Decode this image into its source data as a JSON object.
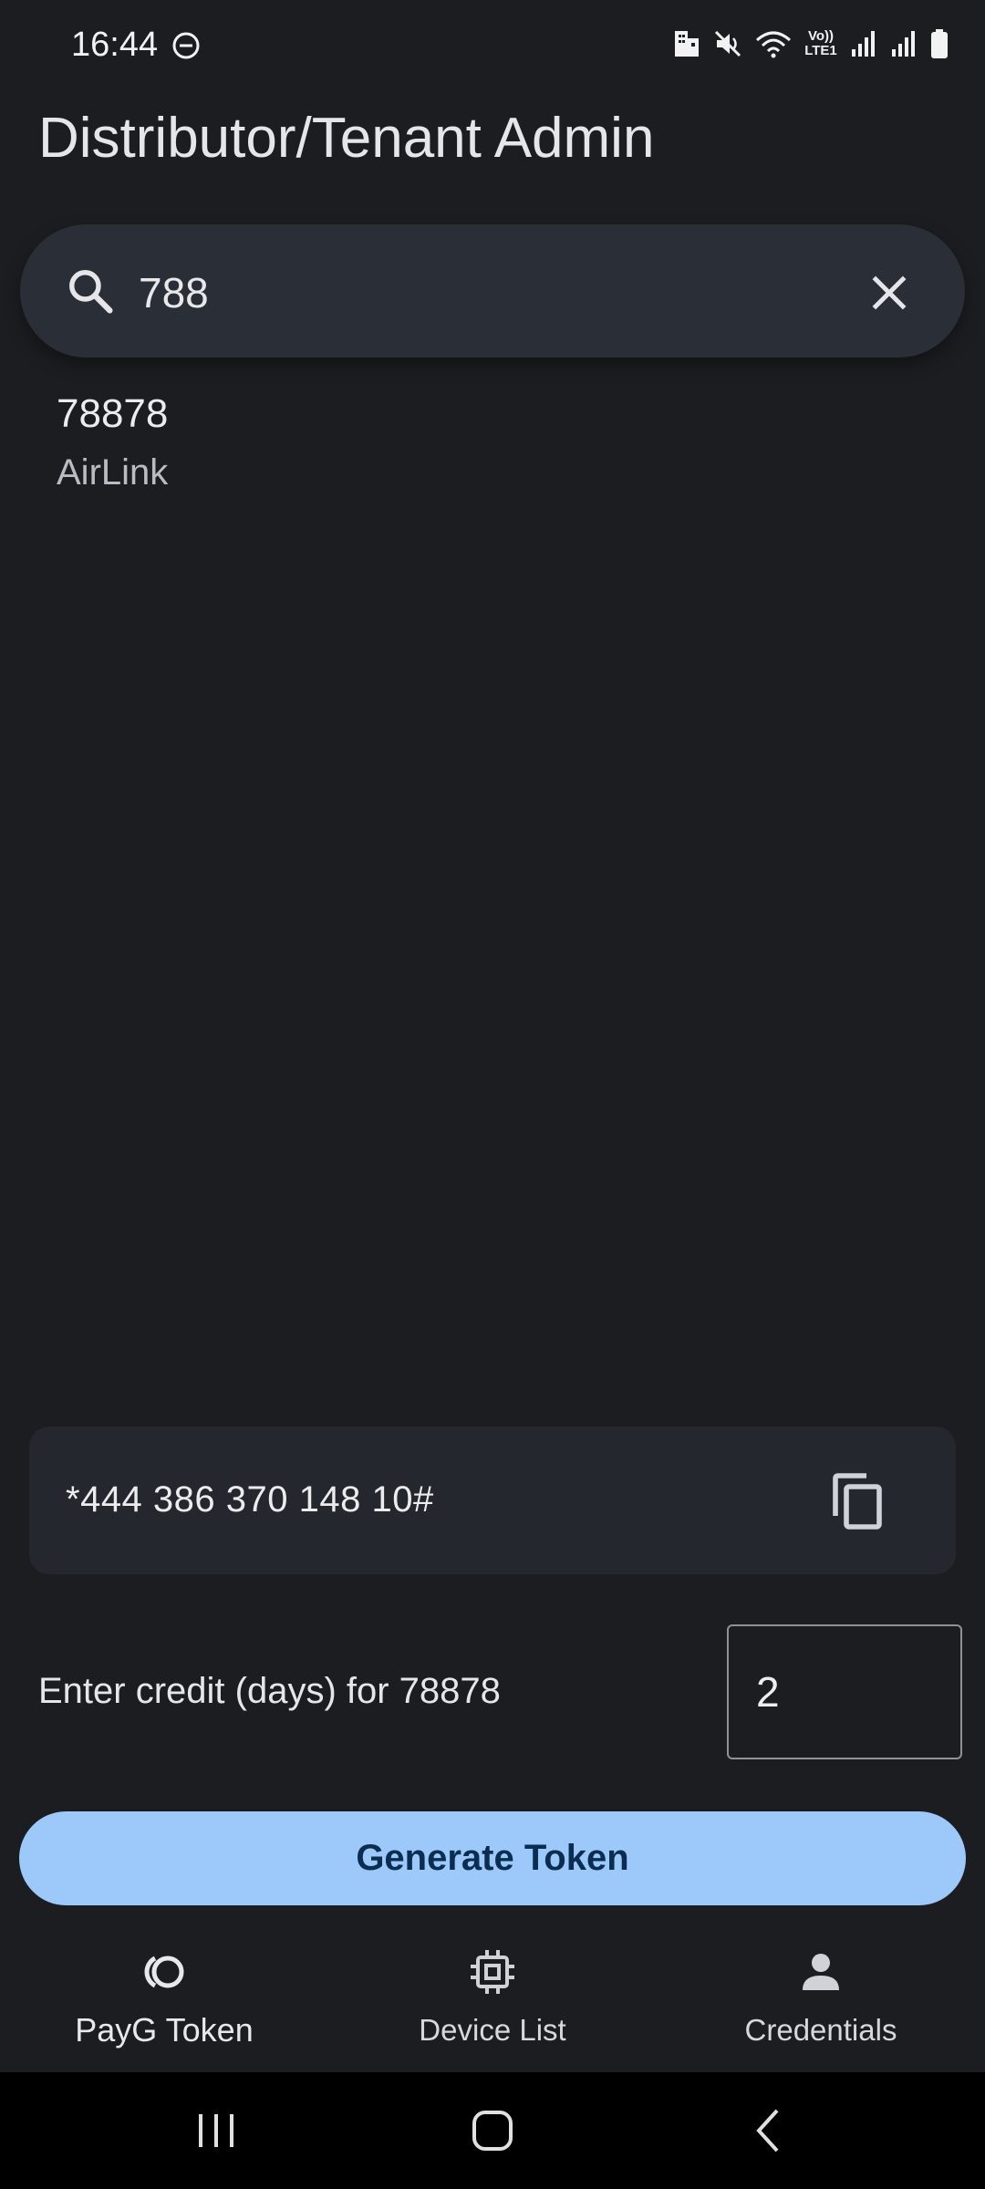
{
  "status_bar": {
    "time": "16:44",
    "icons": [
      "dnd-icon",
      "building-icon",
      "mute-icon",
      "wifi-icon",
      "volte-icon",
      "signal-icon",
      "signal-icon",
      "battery-icon"
    ],
    "volte_text": "Vo)) LTE1"
  },
  "header": {
    "title": "Distributor/Tenant Admin"
  },
  "search": {
    "value": "788",
    "icon": "search-icon",
    "clear_icon": "close-icon"
  },
  "results": [
    {
      "id": "78878",
      "name": "AirLink"
    }
  ],
  "token": {
    "code": "*444 386 370 148 10#",
    "copy_icon": "copy-icon"
  },
  "credit": {
    "label": "Enter credit (days) for 78878",
    "value": "2"
  },
  "generate_button": {
    "label": "Generate Token"
  },
  "bottom_nav": {
    "items": [
      {
        "label": "PayG Token",
        "icon": "payg-token-icon",
        "active": true
      },
      {
        "label": "Device List",
        "icon": "chip-icon",
        "active": false
      },
      {
        "label": "Credentials",
        "icon": "person-icon",
        "active": false
      }
    ]
  },
  "system_nav": [
    "recents-icon",
    "home-icon",
    "back-icon"
  ],
  "colors": {
    "background": "#1c1d20",
    "search_bar": "#2a2f37",
    "card": "#24272d",
    "primary_button": "#9cc8fa",
    "primary_button_text": "#0b2d52"
  }
}
